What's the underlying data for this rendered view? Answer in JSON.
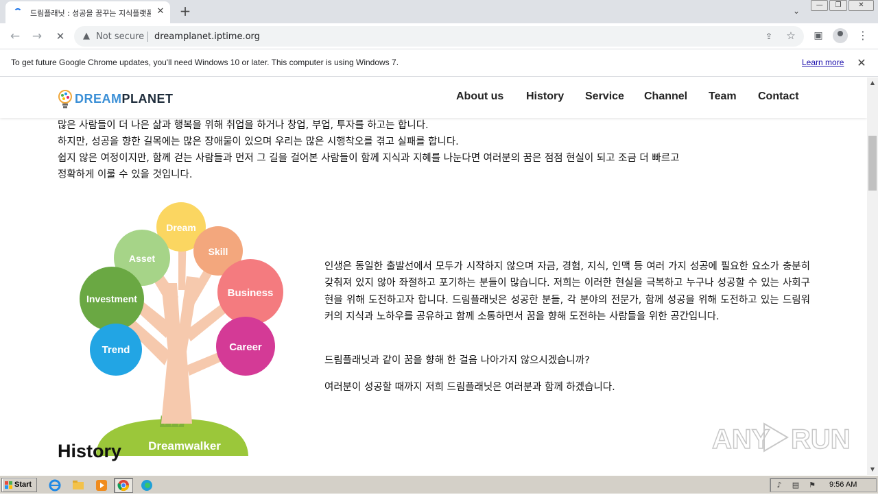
{
  "browser": {
    "tab_title": "드림플래닛 : 성공을 꿈꾸는 지식플랫폼",
    "tab_close": "✕",
    "new_tab": "+",
    "tab_search": "⌄",
    "window_controls": {
      "minimize": "—",
      "restore": "❐",
      "close": "✕"
    },
    "nav": {
      "back": "←",
      "forward": "→",
      "reload": "✕"
    },
    "security_icon": "▲",
    "security_label": "Not secure",
    "url": "dreamplanet.iptime.org",
    "share_icon": "⇪",
    "star_icon": "☆",
    "sidepanel_icon": "▣",
    "menu_icon": "⋮"
  },
  "infobar": {
    "message": "To get future Google Chrome updates, you'll need Windows 10 or later. This computer is using Windows 7.",
    "link": "Learn more",
    "close": "✕"
  },
  "site": {
    "logo_dream": "DREAM",
    "logo_planet": "PLANET",
    "menu": [
      "About us",
      "History",
      "Service",
      "Channel",
      "Team",
      "Contact"
    ],
    "intro_lines": [
      "많은 사람들이 더 나은 삶과 행복을 위해 취업을 하거나 창업, 부업, 투자를 하고는 합니다.",
      "하지만, 성공을 향한 길목에는 많은 장애물이 있으며 우리는 많은 시행착오를 겪고 실패를 합니다.",
      "쉽지 않은 여정이지만, 함께 걷는 사람들과 먼저 그 길을 걸어본 사람들이 함께 지식과 지혜를 나눈다면 여러분의 꿈은 점점 현실이 되고 조금 더 빠르고",
      "정확하게 이룰 수 있을 것입니다."
    ],
    "tree": {
      "bubbles": [
        "Dream",
        "Skill",
        "Asset",
        "Business",
        "Investment",
        "Career",
        "Trend"
      ],
      "base": "Dreamwalker",
      "colors": {
        "dream": "#fbd661",
        "skill": "#f3a77d",
        "asset": "#a6d488",
        "business": "#f47b7f",
        "investment": "#6aa843",
        "career": "#d43a96",
        "trend": "#22a5e4",
        "trunk": "#f6c9ad",
        "ground": "#9bc73a"
      }
    },
    "body_paragraphs": [
      "인생은 동일한 출발선에서 모두가 시작하지 않으며 자금, 경험, 지식, 인맥 등 여러 가지 성공에 필요한 요소가 충분히 갖춰져 있지 않아 좌절하고 포기하는 분들이 많습니다. 저희는 이러한 현실을 극복하고 누구나 성공할 수 있는 사회구현을 위해 도전하고자 합니다. 드림플래닛은 성공한 분들, 각 분야의 전문가, 함께 성공을 위해 도전하고 있는 드림워커의 지식과 노하우를 공유하고 함께 소통하면서 꿈을 향해 도전하는 사람들을 위한 공간입니다.",
      "드림플래닛과 같이 꿈을 향해 한 걸음 나아가지 않으시겠습니까?",
      "여러분이 성공할 때까지 저희 드림플래닛은 여러분과 함께 하겠습니다."
    ],
    "history_heading": "History"
  },
  "watermark": {
    "text_left": "ANY",
    "text_right": "RUN"
  },
  "taskbar": {
    "start_label": "Start",
    "clock": "9:56 AM",
    "apps": [
      "ie-icon",
      "explorer-icon",
      "media-player-icon",
      "chrome-icon",
      "edge-icon"
    ]
  }
}
